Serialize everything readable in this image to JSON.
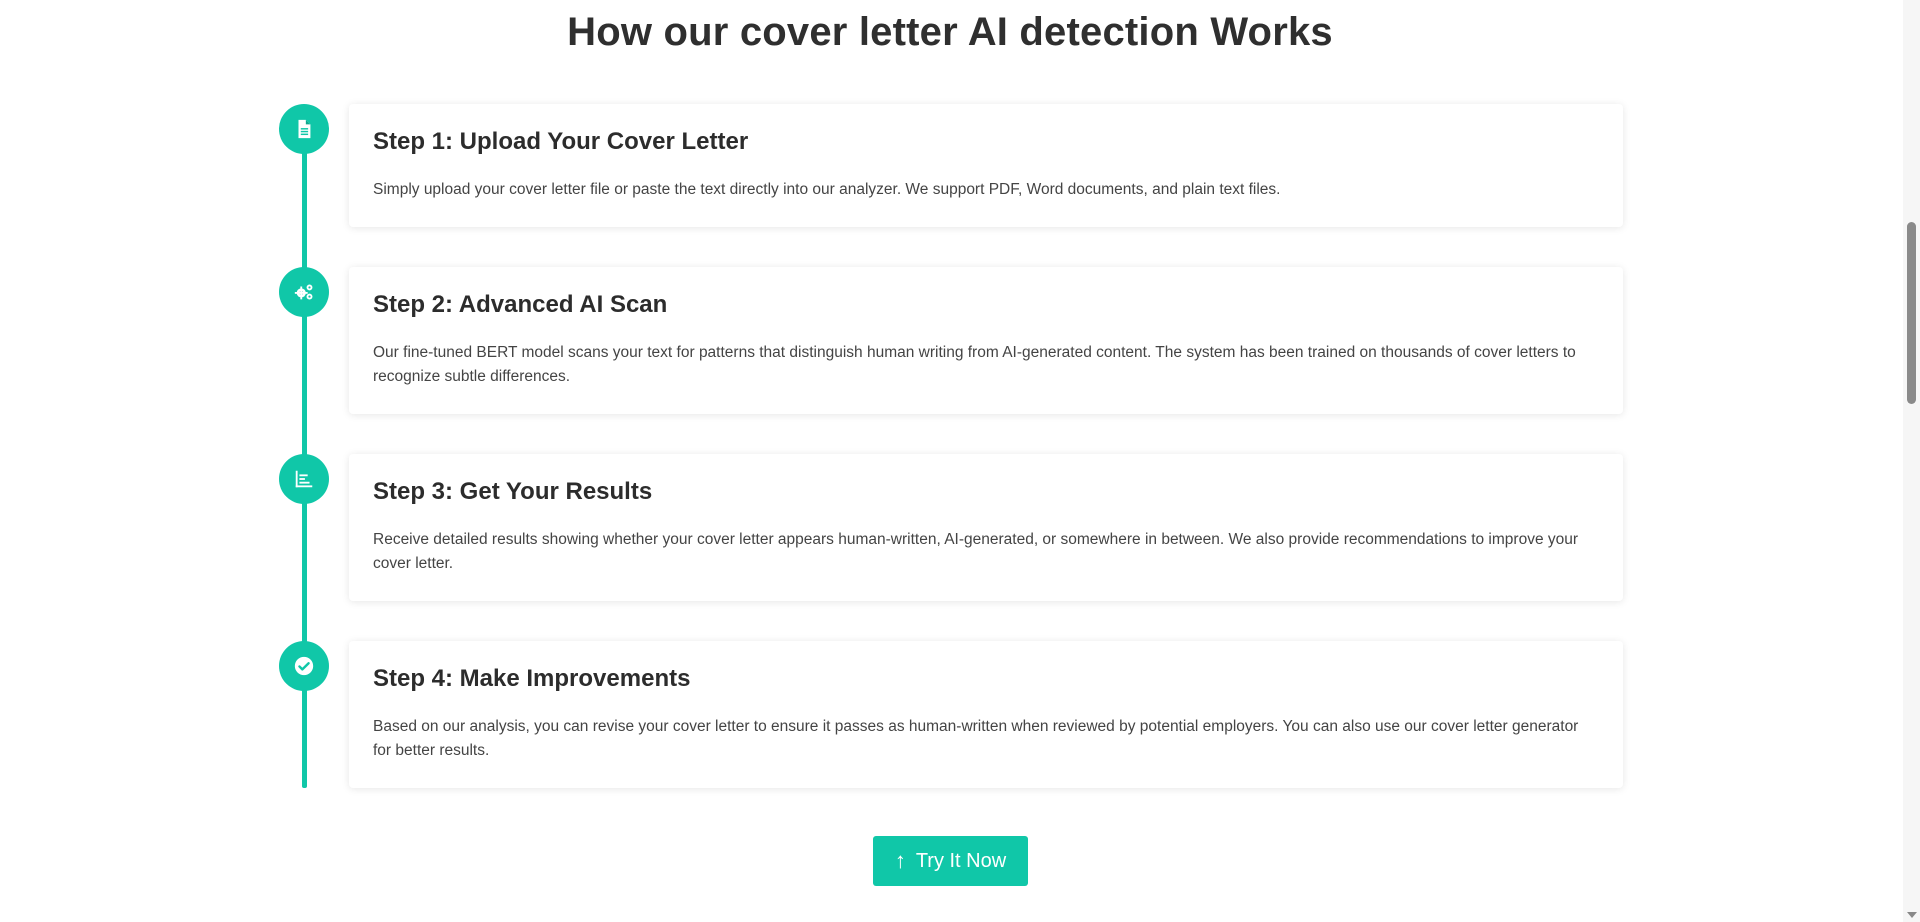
{
  "section": {
    "title": "How our cover letter AI detection Works"
  },
  "steps": [
    {
      "icon": "document-icon",
      "title": "Step 1: Upload Your Cover Letter",
      "description": "Simply upload your cover letter file or paste the text directly into our analyzer. We support PDF, Word documents, and plain text files."
    },
    {
      "icon": "gears-icon",
      "title": "Step 2: Advanced AI Scan",
      "description": "Our fine-tuned BERT model scans your text for patterns that distinguish human writing from AI-generated content. The system has been trained on thousands of cover letters to recognize subtle differences."
    },
    {
      "icon": "chart-icon",
      "title": "Step 3: Get Your Results",
      "description": "Receive detailed results showing whether your cover letter appears human-written, AI-generated, or somewhere in between. We also provide recommendations to improve your cover letter."
    },
    {
      "icon": "check-circle-icon",
      "title": "Step 4: Make Improvements",
      "description": "Based on our analysis, you can revise your cover letter to ensure it passes as human-written when reviewed by potential employers. You can also use our cover letter generator for better results."
    }
  ],
  "cta": {
    "label": "Try It Now",
    "icon": "arrow-up-icon"
  },
  "colors": {
    "accent": "#10c7a8",
    "text": "#333333"
  }
}
